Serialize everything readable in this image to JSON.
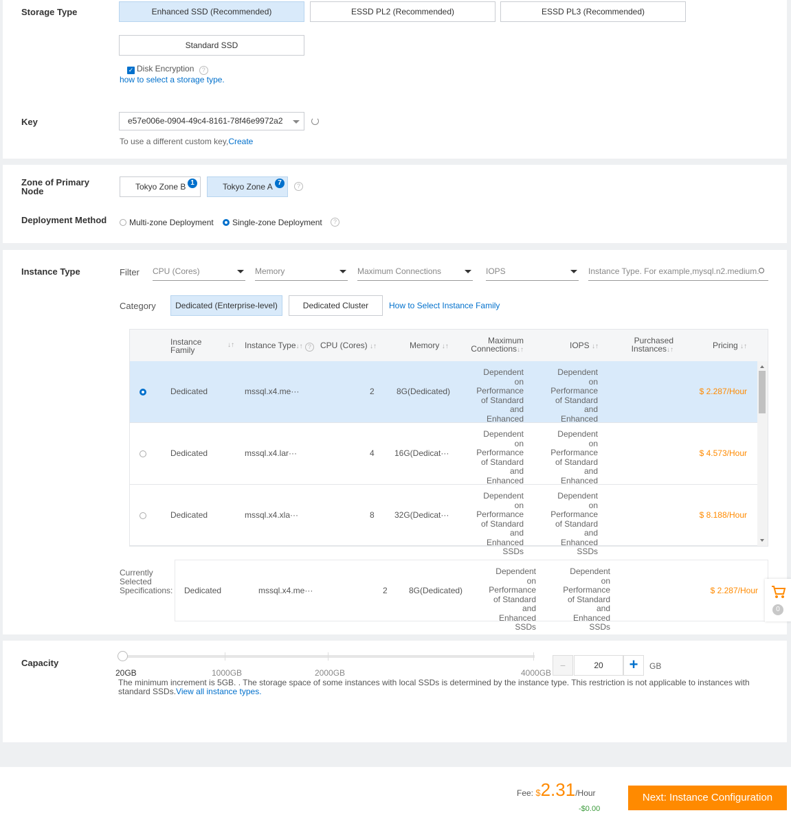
{
  "storage": {
    "label": "Storage Type",
    "options": [
      "Enhanced SSD (Recommended)",
      "ESSD PL2 (Recommended)",
      "ESSD PL3 (Recommended)",
      "Standard SSD"
    ],
    "encryption": "Disk Encryption",
    "help_link": "how to select a storage type."
  },
  "key": {
    "label": "Key",
    "value": "e57e006e-0904-49c4-8161-78f46e9972a2",
    "hint": "To use a different custom key,",
    "create": "Create"
  },
  "zone": {
    "label_line1": "Zone of Primary",
    "label_line2": "Node",
    "options": [
      {
        "name": "Tokyo Zone B",
        "count": "1"
      },
      {
        "name": "Tokyo Zone A",
        "count": "7"
      }
    ]
  },
  "deployment": {
    "label": "Deployment Method",
    "options": [
      "Multi-zone Deployment",
      "Single-zone Deployment"
    ]
  },
  "instance": {
    "label": "Instance Type",
    "filter_label": "Filter",
    "filters": [
      "CPU (Cores)",
      "Memory",
      "Maximum Connections",
      "IOPS"
    ],
    "search_placeholder": "Instance Type. For example,mysql.n2.medium.",
    "category_label": "Category",
    "categories": [
      "Dedicated (Enterprise-level)",
      "Dedicated Cluster"
    ],
    "family_link": "How to Select Instance Family",
    "headers": {
      "family1": "Instance",
      "family2": "Family",
      "type": "Instance Type",
      "cpu": "CPU (Cores)",
      "memory": "Memory",
      "maxconn1": "Maximum",
      "maxconn2": "Connections",
      "iops": "IOPS",
      "purchased1": "Purchased",
      "purchased2": "Instances",
      "pricing": "Pricing"
    },
    "dep_lines": [
      "Dependent on",
      "Performance",
      "of Standard",
      "and Enhanced",
      "SSDs"
    ],
    "rows": [
      {
        "family": "Dedicated",
        "type": "mssql.x4.me···",
        "cpu": "2",
        "memory": "8G(Dedicated)",
        "price": "$ 2.287/Hour"
      },
      {
        "family": "Dedicated",
        "type": "mssql.x4.lar···",
        "cpu": "4",
        "memory": "16G(Dedicat···",
        "price": "$ 4.573/Hour"
      },
      {
        "family": "Dedicated",
        "type": "mssql.x4.xla···",
        "cpu": "8",
        "memory": "32G(Dedicat···",
        "price": "$ 8.188/Hour"
      }
    ],
    "current_label": [
      "Currently",
      "Selected",
      "Specifications:"
    ],
    "current": {
      "family": "Dedicated",
      "type": "mssql.x4.me···",
      "cpu": "2",
      "memory": "8G(Dedicated)",
      "price": "$ 2.287/Hour"
    },
    "cart_count": "0"
  },
  "capacity": {
    "label": "Capacity",
    "ticks": [
      "20GB",
      "1000GB",
      "2000GB",
      "4000GB"
    ],
    "value": "20",
    "unit": "GB",
    "minus": "−",
    "plus": "+",
    "note": "The minimum increment is  5GB. . The storage space of some instances with local SSDs is determined by the instance type. This restriction is not applicable to instances with standard SSDs.",
    "note_link": "View all instance types."
  },
  "footer": {
    "fee_label": "Fee:",
    "currency": "$",
    "amount": "2.31",
    "per": "/Hour",
    "discount": "-$0.00",
    "next": "Next: Instance Configuration"
  },
  "colors": {
    "accent": "#0070cc",
    "orange": "#ff8a00",
    "selected_bg": "#d9eafa"
  }
}
